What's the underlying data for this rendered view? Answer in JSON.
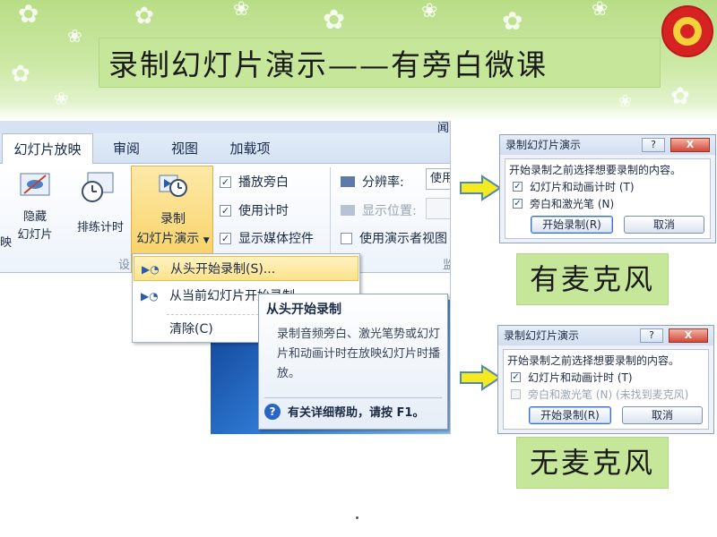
{
  "slide": {
    "title": "录制幻灯片演示——有旁白微课",
    "caption_with_mic": "有麦克风",
    "caption_without_mic": "无麦克风"
  },
  "ribbon": {
    "tabs": [
      {
        "label": "幻灯片放映",
        "active": true
      },
      {
        "label": "审阅",
        "active": false
      },
      {
        "label": "视图",
        "active": false
      },
      {
        "label": "加载项",
        "active": false
      }
    ],
    "tab_overflow": "闻",
    "partial_left_char": "映",
    "hide_slide_line1": "隐藏",
    "hide_slide_line2": "幻灯片",
    "rehearse_label": "排练计时",
    "record_line1": "录制",
    "record_line2": "幻灯片演示",
    "checkboxes": [
      {
        "label": "播放旁白",
        "checked": true
      },
      {
        "label": "使用计时",
        "checked": true
      },
      {
        "label": "显示媒体控件",
        "checked": true
      }
    ],
    "resolution_label": "分辨率:",
    "resolution_value": "使用",
    "show_on_label": "显示位置:",
    "presenter_view_label": "使用演示者视图",
    "group_label_left": "设",
    "group_label_right": "监"
  },
  "record_menu": {
    "items": [
      {
        "label": "从头开始录制(S)..."
      },
      {
        "label": "从当前幻灯片开始录制..."
      },
      {
        "label": "清除(C)"
      }
    ]
  },
  "tooltip": {
    "title": "从头开始录制",
    "body": "录制音频旁白、激光笔势或幻灯片和动画计时在放映幻灯片时播放。",
    "help": "有关详细帮助，请按 F1。"
  },
  "dialog_with_mic": {
    "title": "录制幻灯片演示",
    "help_btn": "?",
    "close_btn": "X",
    "prompt": "开始录制之前选择想要录制的内容。",
    "options": [
      {
        "label": "幻灯片和动画计时 (T)",
        "checked": true,
        "enabled": true
      },
      {
        "label": "旁白和激光笔 (N)",
        "checked": true,
        "enabled": true
      }
    ],
    "start_btn": "开始录制(R)",
    "cancel_btn": "取消"
  },
  "dialog_without_mic": {
    "title": "录制幻灯片演示",
    "help_btn": "?",
    "close_btn": "X",
    "prompt": "开始录制之前选择想要录制的内容。",
    "options": [
      {
        "label": "幻灯片和动画计时 (T)",
        "checked": true,
        "enabled": true
      },
      {
        "label": "旁白和激光笔 (N)  (未找到麦克风)",
        "checked": false,
        "enabled": false
      }
    ],
    "start_btn": "开始录制(R)",
    "cancel_btn": "取消"
  },
  "colors": {
    "title_bg": "#c6e79a",
    "top_band": "#b8dd86",
    "arrow_fill": "#f4ea1f",
    "menu_highlight": "#fde28a"
  }
}
